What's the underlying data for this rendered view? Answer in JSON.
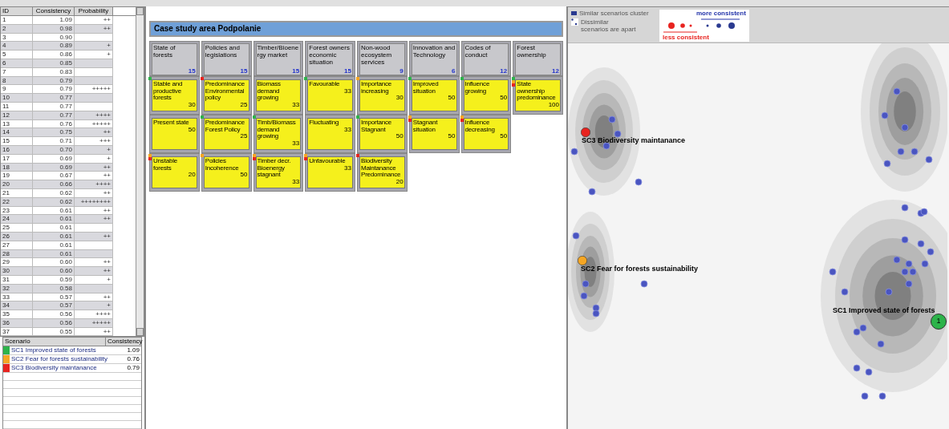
{
  "table": {
    "columns": [
      "ID",
      "Consistency",
      "Probability"
    ],
    "rows": [
      {
        "id": "1",
        "consistency": "1.09",
        "probability": "++"
      },
      {
        "id": "2",
        "consistency": "0.98",
        "probability": "++"
      },
      {
        "id": "3",
        "consistency": "0.90"
      },
      {
        "id": "4",
        "consistency": "0.89",
        "probability": "+"
      },
      {
        "id": "5",
        "consistency": "0.86",
        "probability": "+"
      },
      {
        "id": "6",
        "consistency": "0.85"
      },
      {
        "id": "7",
        "consistency": "0.83"
      },
      {
        "id": "8",
        "consistency": "0.79"
      },
      {
        "id": "9",
        "consistency": "0.79",
        "probability": "+++++"
      },
      {
        "id": "10",
        "consistency": "0.77"
      },
      {
        "id": "11",
        "consistency": "0.77"
      },
      {
        "id": "12",
        "consistency": "0.77",
        "probability": "++++"
      },
      {
        "id": "13",
        "consistency": "0.76",
        "probability": "+++++"
      },
      {
        "id": "14",
        "consistency": "0.75",
        "probability": "++"
      },
      {
        "id": "15",
        "consistency": "0.71",
        "probability": "+++"
      },
      {
        "id": "16",
        "consistency": "0.70",
        "probability": "+"
      },
      {
        "id": "17",
        "consistency": "0.69",
        "probability": "+"
      },
      {
        "id": "18",
        "consistency": "0.69",
        "probability": "++"
      },
      {
        "id": "19",
        "consistency": "0.67",
        "probability": "++"
      },
      {
        "id": "20",
        "consistency": "0.66",
        "probability": "++++"
      },
      {
        "id": "21",
        "consistency": "0.62",
        "probability": "++"
      },
      {
        "id": "22",
        "consistency": "0.62",
        "probability": "++++++++"
      },
      {
        "id": "23",
        "consistency": "0.61",
        "probability": "++"
      },
      {
        "id": "24",
        "consistency": "0.61",
        "probability": "++"
      },
      {
        "id": "25",
        "consistency": "0.61"
      },
      {
        "id": "26",
        "consistency": "0.61",
        "probability": "++"
      },
      {
        "id": "27",
        "consistency": "0.61"
      },
      {
        "id": "28",
        "consistency": "0.61"
      },
      {
        "id": "29",
        "consistency": "0.60",
        "probability": "++"
      },
      {
        "id": "30",
        "consistency": "0.60",
        "probability": "++"
      },
      {
        "id": "31",
        "consistency": "0.59",
        "probability": "+"
      },
      {
        "id": "32",
        "consistency": "0.58"
      },
      {
        "id": "33",
        "consistency": "0.57",
        "probability": "++"
      },
      {
        "id": "34",
        "consistency": "0.57",
        "probability": "+"
      },
      {
        "id": "35",
        "consistency": "0.56",
        "probability": "++++"
      },
      {
        "id": "36",
        "consistency": "0.56",
        "probability": "+++++"
      },
      {
        "id": "37",
        "consistency": "0.55",
        "probability": "++"
      }
    ]
  },
  "scenarios": {
    "columns": [
      "Scenario",
      "Consistency"
    ],
    "rows": [
      {
        "name": "SC1 Improved state of forests",
        "consistency": "1.09",
        "color": "#2db34a"
      },
      {
        "name": "SC2 Fear for forests sustainability",
        "consistency": "0.76",
        "color": "#f5a623"
      },
      {
        "name": "SC3 Biodiversity maintanance",
        "consistency": "0.79",
        "color": "#e8231f"
      }
    ]
  },
  "case_study": {
    "title": "Case study area Podpolanie",
    "descriptors": [
      {
        "name": "State of forests",
        "weight": "15",
        "states": [
          {
            "label": "Stable and productive forests",
            "value": "30",
            "markers": [
              {
                "color": "#2db34a"
              }
            ]
          },
          {
            "label": "Present state",
            "value": "50"
          },
          {
            "label": "Unstable forests",
            "value": "20",
            "markers": [
              {
                "color": "#f5a623"
              },
              {
                "color": "#e8231f"
              }
            ]
          }
        ]
      },
      {
        "name": "Policies and legislations",
        "weight": "15",
        "states": [
          {
            "label": "Predominance Environmental policy",
            "value": "25",
            "markers": [
              {
                "color": "#e8231f"
              }
            ]
          },
          {
            "label": "Predominance Forest Policy",
            "value": "25",
            "markers": [
              {
                "color": "#2db34a"
              }
            ]
          },
          {
            "label": "Policies Incoherence",
            "value": "50",
            "markers": [
              {
                "color": "#f5a623"
              }
            ]
          }
        ]
      },
      {
        "name": "Timber/Bioenergy market",
        "weight": "15",
        "states": [
          {
            "label": "Biomass demand growing",
            "value": "33"
          },
          {
            "label": "Timb/Biomass demand growing",
            "value": "33",
            "markers": [
              {
                "color": "#2db34a"
              }
            ]
          },
          {
            "label": "Timber decr. Bioenergy stagnant",
            "value": "33",
            "markers": [
              {
                "color": "#f5a623"
              },
              {
                "color": "#e8231f"
              }
            ]
          }
        ]
      },
      {
        "name": "Forest owners economic situation",
        "weight": "15",
        "states": [
          {
            "label": "Favourable",
            "value": "33",
            "markers": [
              {
                "color": "#2db34a"
              }
            ]
          },
          {
            "label": "Fluctuating",
            "value": "33"
          },
          {
            "label": "Unfavourable",
            "value": "33",
            "markers": [
              {
                "color": "#f5a623"
              },
              {
                "color": "#e8231f"
              }
            ]
          }
        ]
      },
      {
        "name": "Non-wood ecosystem services",
        "weight": "9",
        "states": [
          {
            "label": "Importance increasing",
            "value": "30",
            "markers": [
              {
                "color": "#f5a623"
              }
            ]
          },
          {
            "label": "Importance Stagnant",
            "value": "50",
            "markers": [
              {
                "color": "#2db34a"
              }
            ]
          },
          {
            "label": "Biodiversity Maintanance Predominance",
            "value": "20",
            "markers": [
              {
                "color": "#e8231f"
              }
            ]
          }
        ]
      },
      {
        "name": "Innovation and Technology",
        "weight": "6",
        "states": [
          {
            "label": "Improved situation",
            "value": "50",
            "markers": [
              {
                "color": "#2db34a"
              }
            ]
          },
          {
            "label": "Stagnant situation",
            "value": "50",
            "markers": [
              {
                "color": "#f5a623"
              },
              {
                "color": "#e8231f"
              }
            ]
          }
        ]
      },
      {
        "name": "Codes of conduct",
        "weight": "12",
        "states": [
          {
            "label": "Influence growing",
            "value": "50",
            "markers": [
              {
                "color": "#2db34a"
              }
            ]
          },
          {
            "label": "Influence decreasing",
            "value": "50",
            "markers": [
              {
                "color": "#f5a623"
              },
              {
                "color": "#e8231f"
              }
            ]
          }
        ]
      },
      {
        "name": "Forest ownership",
        "weight": "12",
        "states": [
          {
            "label": "State ownership predominance",
            "value": "100",
            "markers": [
              {
                "color": "#2db34a"
              },
              {
                "color": "#f5a623"
              },
              {
                "color": "#e8231f"
              }
            ]
          }
        ]
      }
    ]
  },
  "map": {
    "legend": {
      "similar": "Similar scenarios cluster",
      "dissimilar": "Dissimilar scenarios are apart",
      "more": "more consistent",
      "less": "less consistent"
    },
    "scenario_nodes": [
      {
        "label": "SC3 Biodiversity maintanance",
        "color": "#e8231f"
      },
      {
        "label": "SC2 Fear for forests sustainability",
        "color": "#f5a623"
      },
      {
        "label": "SC1 Improved state of forests",
        "color": "#2db34a",
        "number": "1"
      }
    ]
  }
}
